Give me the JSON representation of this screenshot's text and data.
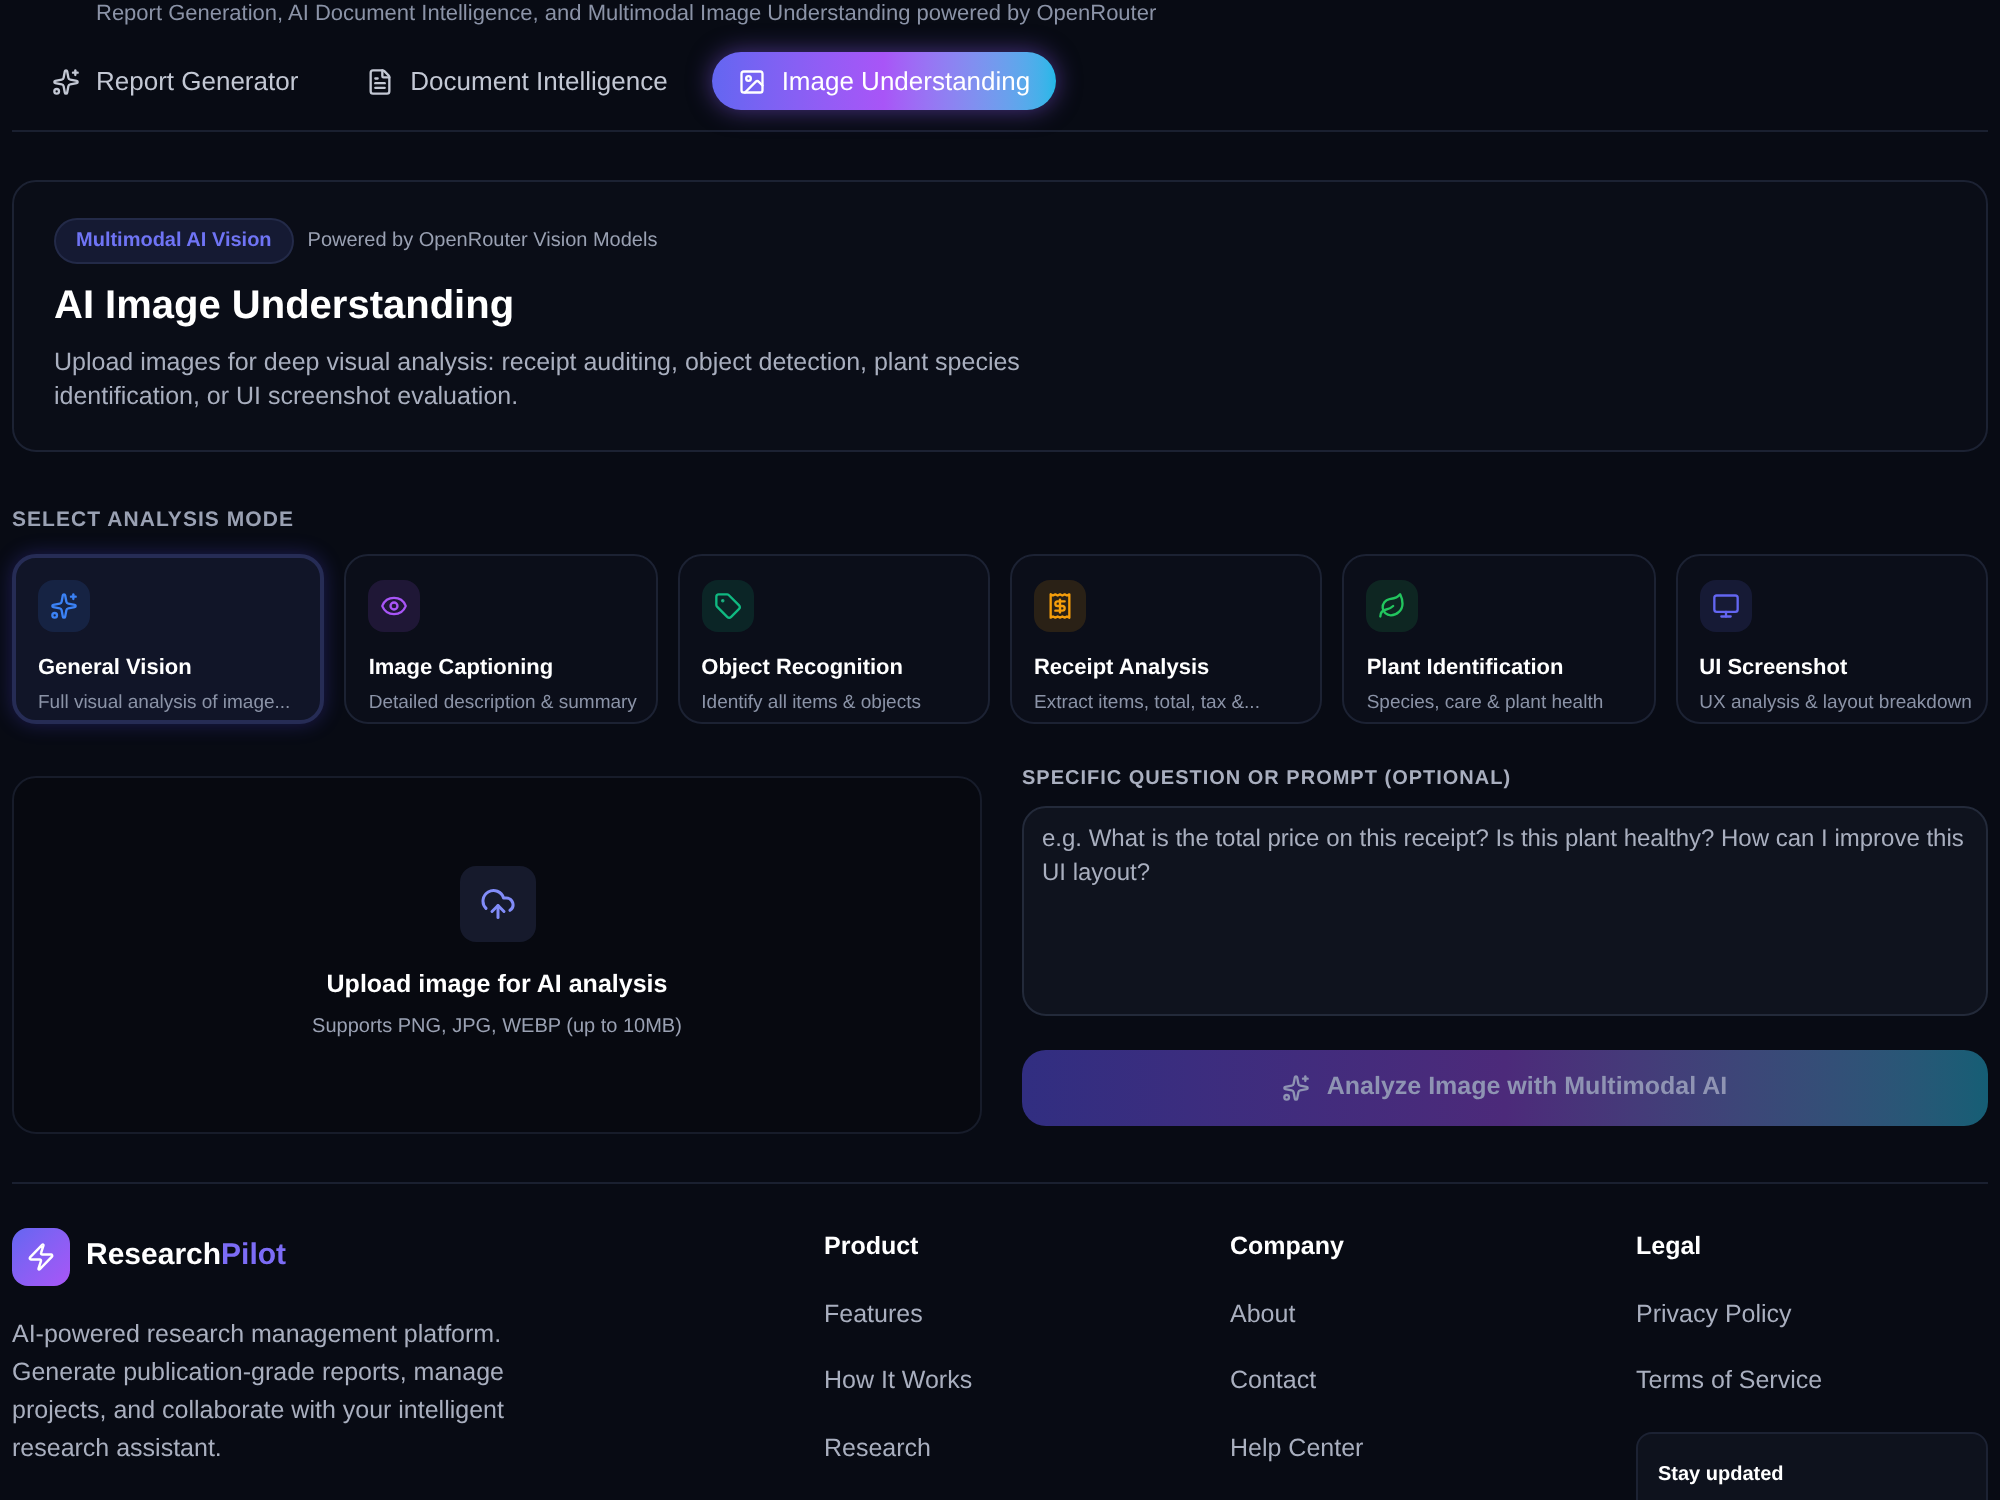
{
  "header": {
    "subtitle": "Report Generation, AI Document Intelligence, and Multimodal Image Understanding powered by OpenRouter"
  },
  "tabs": [
    {
      "label": "Report Generator",
      "selected": false
    },
    {
      "label": "Document Intelligence",
      "selected": false
    },
    {
      "label": "Image Understanding",
      "selected": true
    }
  ],
  "hero": {
    "badge": "Multimodal AI Vision",
    "powered_by": "Powered by OpenRouter Vision Models",
    "title": "AI Image Understanding",
    "description": "Upload images for deep visual analysis: receipt auditing, object detection, plant species identification, or UI screenshot evaluation."
  },
  "modes": {
    "label": "SELECT ANALYSIS MODE",
    "items": [
      {
        "title": "General Vision",
        "description": "Full visual analysis of image...",
        "color": "#3b82f6",
        "selected": true
      },
      {
        "title": "Image Captioning",
        "description": "Detailed description & summary",
        "color": "#a855f7",
        "selected": false
      },
      {
        "title": "Object Recognition",
        "description": "Identify all items & objects",
        "color": "#10b981",
        "selected": false
      },
      {
        "title": "Receipt Analysis",
        "description": "Extract items, total, tax &...",
        "color": "#f59e0b",
        "selected": false
      },
      {
        "title": "Plant Identification",
        "description": "Species, care & plant health",
        "color": "#22c55e",
        "selected": false
      },
      {
        "title": "UI Screenshot",
        "description": "UX analysis & layout breakdown",
        "color": "#6366f1",
        "selected": false
      }
    ]
  },
  "upload": {
    "title": "Upload image for AI analysis",
    "hint": "Supports PNG, JPG, WEBP (up to 10MB)"
  },
  "prompt": {
    "label": "SPECIFIC QUESTION OR PROMPT (OPTIONAL)",
    "placeholder": "e.g. What is the total price on this receipt? Is this plant healthy? How can I improve this UI layout?"
  },
  "analyze_button": {
    "label": "Analyze Image with Multimodal AI",
    "disabled": true
  },
  "footer": {
    "brand": [
      "Research",
      "Pilot"
    ],
    "description": "AI-powered research management platform. Generate publication-grade reports, manage projects, and collaborate with your intelligent research assistant.",
    "columns": [
      {
        "heading": "Product",
        "links": [
          "Features",
          "How It Works",
          "Research"
        ]
      },
      {
        "heading": "Company",
        "links": [
          "About",
          "Contact",
          "Help Center"
        ]
      },
      {
        "heading": "Legal",
        "links": [
          "Privacy Policy",
          "Terms of Service"
        ]
      }
    ],
    "newsletter": {
      "title": "Stay updated"
    }
  }
}
